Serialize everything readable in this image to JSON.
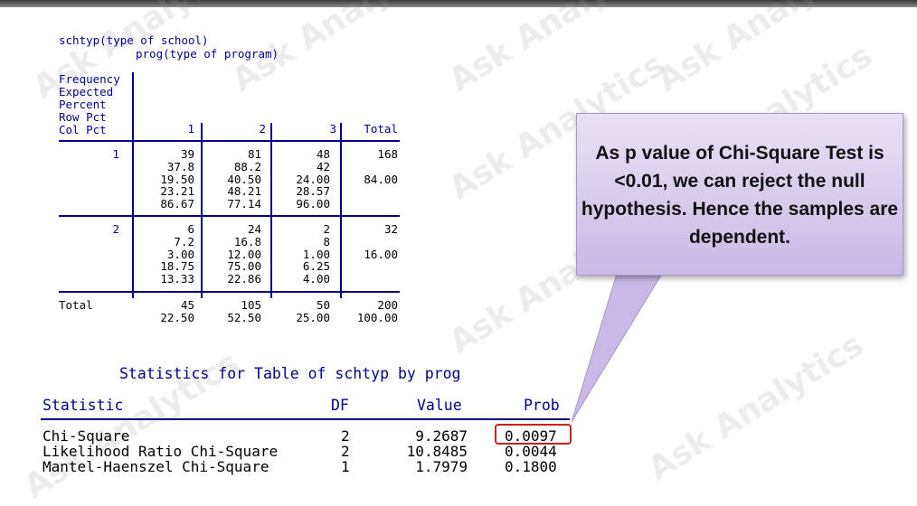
{
  "watermark": "Ask Analytics",
  "crosstab": {
    "title_line1": "schtyp(type of school)",
    "title_line2": "prog(type of program)",
    "legend": [
      "Frequency",
      "Expected",
      "Percent",
      "Row Pct",
      "Col Pct"
    ],
    "col_headers": [
      "1",
      "2",
      "3",
      "Total"
    ],
    "rows": [
      {
        "label": "1",
        "cells": [
          [
            "39",
            "37.8",
            "19.50",
            "23.21",
            "86.67"
          ],
          [
            "81",
            "88.2",
            "40.50",
            "48.21",
            "77.14"
          ],
          [
            "48",
            "42",
            "24.00",
            "28.57",
            "96.00"
          ]
        ],
        "total": [
          "168",
          "",
          "84.00"
        ]
      },
      {
        "label": "2",
        "cells": [
          [
            "6",
            "7.2",
            "3.00",
            "18.75",
            "13.33"
          ],
          [
            "24",
            "16.8",
            "12.00",
            "75.00",
            "22.86"
          ],
          [
            "2",
            "8",
            "1.00",
            "6.25",
            "4.00"
          ]
        ],
        "total": [
          "32",
          "",
          "16.00"
        ]
      }
    ],
    "total_row": {
      "label": "Total",
      "counts": [
        "45",
        "105",
        "50",
        "200"
      ],
      "pcts": [
        "22.50",
        "52.50",
        "25.00",
        "100.00"
      ]
    }
  },
  "stats": {
    "title": "Statistics for Table of schtyp by prog",
    "headers": [
      "Statistic",
      "DF",
      "Value",
      "Prob"
    ],
    "rows": [
      {
        "statistic": "Chi-Square",
        "df": "2",
        "value": "9.2687",
        "prob": "0.0097"
      },
      {
        "statistic": "Likelihood Ratio Chi-Square",
        "df": "2",
        "value": "10.8485",
        "prob": "0.0044"
      },
      {
        "statistic": "Mantel-Haenszel Chi-Square",
        "df": "1",
        "value": "1.7979",
        "prob": "0.1800"
      }
    ],
    "highlight_color": "#cc1f1f"
  },
  "callout": {
    "text": "As p value of Chi-Square Test is <0.01, we can reject the null hypothesis.  Hence the samples are dependent."
  }
}
